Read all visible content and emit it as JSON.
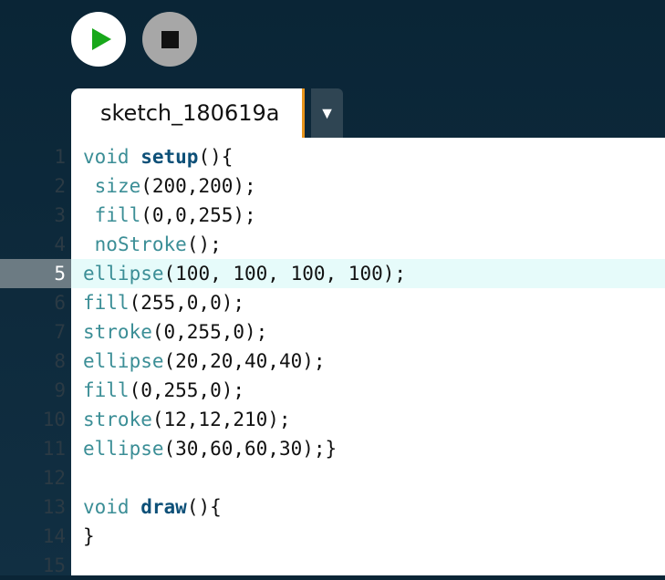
{
  "toolbar": {
    "run_label": "",
    "stop_label": ""
  },
  "tab": {
    "title": "sketch_180619a",
    "menu_glyph": "▼"
  },
  "editor": {
    "current_line": 5,
    "lines": [
      {
        "num": "1",
        "text": "void setup(){"
      },
      {
        "num": "2",
        "text": " size(200,200);"
      },
      {
        "num": "3",
        "text": " fill(0,0,255);"
      },
      {
        "num": "4",
        "text": " noStroke();"
      },
      {
        "num": "5",
        "text": "ellipse(100, 100, 100, 100);"
      },
      {
        "num": "6",
        "text": "fill(255,0,0);"
      },
      {
        "num": "7",
        "text": "stroke(0,255,0);"
      },
      {
        "num": "8",
        "text": "ellipse(20,20,40,40);"
      },
      {
        "num": "9",
        "text": "fill(0,255,0);"
      },
      {
        "num": "10",
        "text": "stroke(12,12,210);"
      },
      {
        "num": "11",
        "text": "ellipse(30,60,60,30);}"
      },
      {
        "num": "12",
        "text": ""
      },
      {
        "num": "13",
        "text": "void draw(){"
      },
      {
        "num": "14",
        "text": "}"
      },
      {
        "num": "15",
        "text": ""
      }
    ]
  },
  "colors": {
    "run": "#18a81a",
    "accent": "#e8951c",
    "background": "#0e2a3c"
  }
}
